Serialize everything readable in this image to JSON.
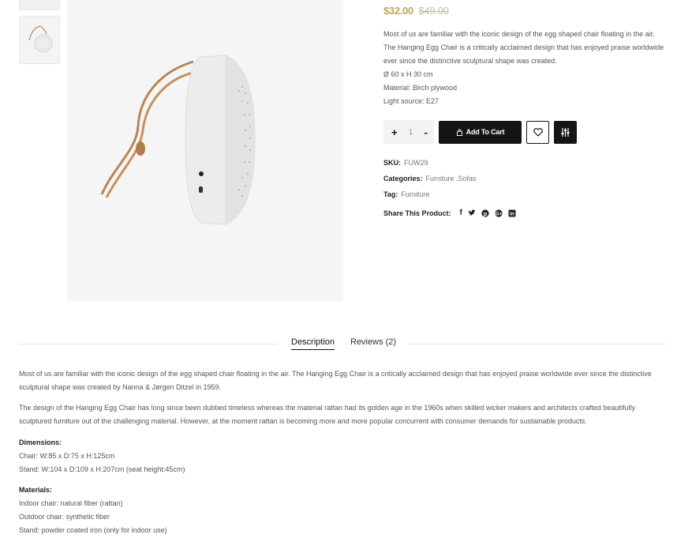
{
  "product": {
    "price_now": "$32.00",
    "price_old": "$49.00",
    "short_desc": [
      "Most of us are familiar with the iconic design of the egg shaped chair floating in the air.",
      "The Hanging Egg Chair is a critically acclaimed design that has enjoyed praise worldwide",
      "ever since the distinctive sculptural shape was created.",
      "Ø 60 x H 30 cm",
      "Material: Birch plywood",
      "Light source: E27"
    ],
    "qty_plus": "+",
    "qty_value": "1",
    "qty_minus": "-",
    "add_to_cart": "Add To Cart",
    "sku_label": "SKU:",
    "sku_value": "FUW29",
    "categories_label": "Categories:",
    "categories_value": "Furniture ,Sofas",
    "tag_label": "Tag:",
    "tag_value": "Furniture",
    "share_label": "Share This Product:",
    "share_icons": [
      "facebook-icon",
      "twitter-icon",
      "pinterest-icon",
      "google-plus-icon",
      "linkedin-icon"
    ]
  },
  "tabs": {
    "description": "Description",
    "reviews": "Reviews (2)"
  },
  "description": {
    "p1_line1": "Most of us are familiar with the iconic design of the egg shaped chair floating in the air. The Hanging Egg Chair is a critically acclaimed design that has enjoyed praise worldwide ever since the distinctive",
    "p1_line2": "sculptural shape was created by Nanna & Jørgen Ditzel in 1959.",
    "p2_line1": "The design of the Hanging Egg Chair has long since been dubbed timeless whereas the material rattan had its golden age in the 1960s when skilled wicker makers and architects crafted beautifully",
    "p2_line2": "sculptured furniture out of the challenging material. However, at the moment rattan is becoming more and more popular concurrent with consumer demands for sustainable products.",
    "dimensions_heading": "Dimensions:",
    "dim_chair": "Chair: W:85 x D:75 x H:125cm",
    "dim_stand": "Stand: W:104 x D:109 x H:207cm (seat height:45cm)",
    "materials_heading": "Materials:",
    "mat_indoor": "Indoor chair: natural fiber (rattan)",
    "mat_outdoor": "Outdoor chair: synthetic fiber",
    "mat_stand": "Stand: powder coated iron (only for indoor use)"
  },
  "colors": {
    "accent": "#c3a35a",
    "dark": "#151515"
  }
}
